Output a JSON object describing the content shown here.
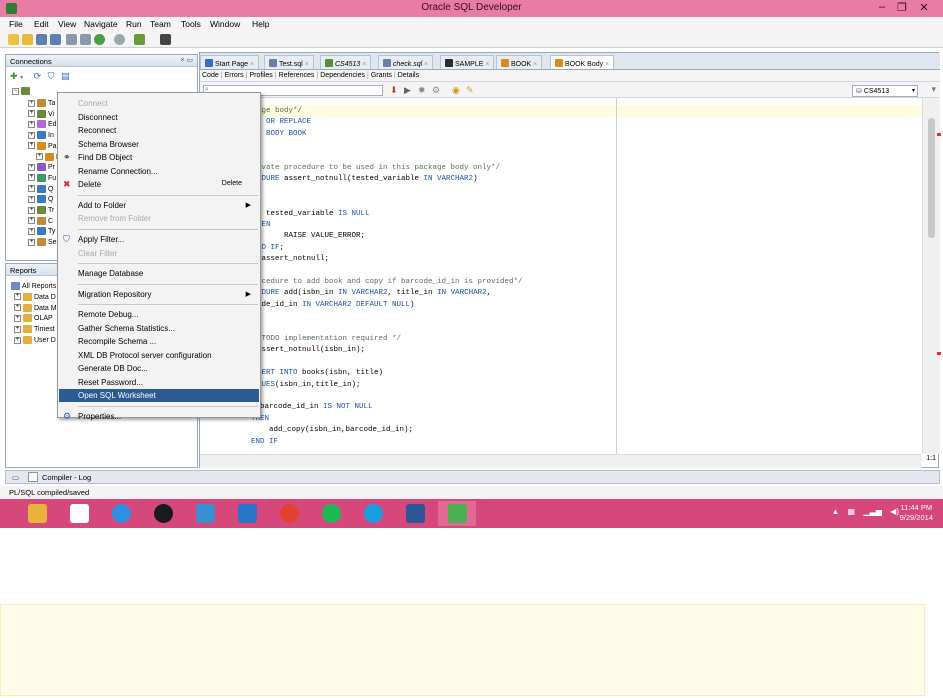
{
  "window": {
    "title": "Oracle SQL Developer",
    "controls": {
      "minimize": "–",
      "restore": "❐",
      "close": "✕"
    }
  },
  "menubar": [
    "File",
    "Edit",
    "View",
    "Navigate",
    "Run",
    "Team",
    "Tools",
    "Window",
    "Help"
  ],
  "connections_pane": {
    "title": "Connections",
    "tree": [
      "Ta",
      "Vi",
      "Ed",
      "In",
      "Pa",
      "P",
      "Pr",
      "Fu",
      "Q",
      "Q",
      "Tr",
      "C",
      "Ty",
      "Se"
    ]
  },
  "reports_pane": {
    "title": "Reports",
    "tree": [
      "All Reports",
      "Data D",
      "Data M",
      "OLAP",
      "Timest",
      "User D"
    ]
  },
  "editor": {
    "tabs": [
      {
        "label": "Start Page",
        "icon": "help-icon",
        "color": "#3b6cc9"
      },
      {
        "label": "Test.sql",
        "icon": "sql-file-icon",
        "color": "#6a7fa8"
      },
      {
        "label": "CS4513",
        "icon": "connection-icon",
        "color": "#5a8a3a"
      },
      {
        "label": "check.sql",
        "icon": "sql-file-icon",
        "color": "#6a7fa8"
      },
      {
        "label": "SAMPLE",
        "icon": "sql-file-icon",
        "color": "#2b2b2b"
      },
      {
        "label": "BOOK",
        "icon": "package-icon",
        "color": "#d98b1e"
      },
      {
        "label": "BOOK Body",
        "icon": "package-body-icon",
        "color": "#d98b1e"
      }
    ],
    "subtabs": [
      "Code",
      "Errors",
      "Profiles",
      "References",
      "Dependencies",
      "Grants",
      "Details"
    ],
    "search_value": "",
    "connection_selected": "CS4513",
    "cursor_position": "1:1",
    "code_lines": [
      [
        {
          "t": "age body*/",
          "c": "cm"
        }
      ],
      [
        {
          "t": "  ",
          "c": ""
        },
        {
          "t": "OR REPLACE",
          "c": "kw"
        }
      ],
      [
        {
          "t": "E BODY BOOK",
          "c": "kw"
        }
      ],
      [],
      [],
      [
        {
          "t": "ivate procedure to be used in this package body only*/",
          "c": "cm"
        }
      ],
      [
        {
          "t": "EDURE",
          "c": "kw"
        },
        {
          "t": " assert_notnull(tested_variable ",
          "c": ""
        },
        {
          "t": "IN VARCHAR2",
          "c": "kw"
        },
        {
          "t": ")",
          "c": ""
        }
      ],
      [],
      [
        {
          "t": "N",
          "c": "kw"
        }
      ],
      [
        {
          "t": "F",
          "c": "kw"
        },
        {
          "t": " tested_variable ",
          "c": ""
        },
        {
          "t": "IS NULL",
          "c": "kw"
        }
      ],
      [
        {
          "t": "HEN",
          "c": "kw"
        }
      ],
      [
        {
          "t": "      RAISE VALUE_ERROR;",
          "c": ""
        }
      ],
      [
        {
          "t": "ND IF",
          "c": "kw"
        },
        {
          "t": ";",
          "c": ""
        }
      ],
      [
        {
          "t": " assert_notnull;",
          "c": ""
        }
      ],
      [],
      [
        {
          "t": "ocedure to add book and copy if barcode_id_in is provided*/",
          "c": "cm"
        }
      ],
      [
        {
          "t": "EDURE",
          "c": "kw"
        },
        {
          "t": " add(isbn_in ",
          "c": ""
        },
        {
          "t": "IN VARCHAR2",
          "c": "kw"
        },
        {
          "t": ", title_in ",
          "c": ""
        },
        {
          "t": "IN VARCHAR2",
          "c": "kw"
        },
        {
          "t": ",",
          "c": ""
        }
      ],
      [
        {
          "t": "ode_id_in ",
          "c": ""
        },
        {
          "t": "IN VARCHAR2 DEFAULT NULL",
          "c": "kw"
        },
        {
          "t": ")",
          "c": ""
        }
      ],
      [],
      [
        {
          "t": "N",
          "c": "kw"
        }
      ],
      [
        {
          "t": " TODO implementation required */",
          "c": "cm"
        }
      ],
      [
        {
          "t": "assert_notnull(isbn_in);",
          "c": ""
        }
      ],
      [],
      [
        {
          "t": "SERT INTO",
          "c": "kw"
        },
        {
          "t": " books(isbn, title)",
          "c": ""
        }
      ],
      [
        {
          "t": "LUES",
          "c": "kw"
        },
        {
          "t": "(isbn_in,title_in);",
          "c": ""
        }
      ],
      [],
      [
        {
          "t": "  barcode_id_in ",
          "c": ""
        },
        {
          "t": "IS NOT NULL",
          "c": "kw"
        }
      ],
      [
        {
          "t": "THEN",
          "c": "kw"
        }
      ],
      [
        {
          "t": "    add_copy(isbn_in,barcode_id_in);",
          "c": ""
        }
      ],
      [
        {
          "t": "END IF",
          "c": "kw"
        }
      ]
    ]
  },
  "context_menu": {
    "items": [
      {
        "label": "Connect",
        "disabled": true
      },
      {
        "label": "Disconnect"
      },
      {
        "label": "Reconnect"
      },
      {
        "label": "Schema Browser"
      },
      {
        "label": "Find DB Object",
        "icon": "binoculars-icon"
      },
      {
        "label": "Rename Connection..."
      },
      {
        "label": "Delete",
        "icon": "delete-x-icon",
        "shortcut": "Delete"
      },
      {
        "sep": true
      },
      {
        "label": "Add to Folder",
        "submenu": true
      },
      {
        "label": "Remove from Folder",
        "disabled": true
      },
      {
        "sep": true
      },
      {
        "label": "Apply Filter...",
        "icon": "filter-icon"
      },
      {
        "label": "Clear Filter",
        "disabled": true
      },
      {
        "sep": true
      },
      {
        "label": "Manage Database"
      },
      {
        "sep": true
      },
      {
        "label": "Migration Repository",
        "submenu": true
      },
      {
        "sep": true
      },
      {
        "label": "Remote Debug..."
      },
      {
        "label": "Gather Schema Statistics..."
      },
      {
        "label": "Recompile Schema ..."
      },
      {
        "label": "XML DB Protocol server configuration"
      },
      {
        "label": "Generate DB Doc..."
      },
      {
        "label": "Reset Password..."
      },
      {
        "label": "Open SQL Worksheet",
        "selected": true
      },
      {
        "sep": true
      },
      {
        "label": "Properties...",
        "icon": "properties-icon"
      }
    ]
  },
  "log": {
    "title": "Compiler - Log"
  },
  "status": "PL/SQL compiled/saved",
  "taskbar": {
    "apps": [
      {
        "name": "file-explorer-icon",
        "color": "#e8b33a"
      },
      {
        "name": "home-icon",
        "color": "#ffffff"
      },
      {
        "name": "internet-explorer-icon",
        "color": "#2f8fe0"
      },
      {
        "name": "media-icon",
        "color": "#1a1a1a"
      },
      {
        "name": "remote-desktop-icon",
        "color": "#3a8fd0"
      },
      {
        "name": "mail-icon",
        "color": "#2a75c8"
      },
      {
        "name": "chrome-icon",
        "color": "#e5402f"
      },
      {
        "name": "spotify-icon",
        "color": "#1db954"
      },
      {
        "name": "skype-icon",
        "color": "#1a9ee0"
      },
      {
        "name": "word-icon",
        "color": "#2b5797"
      },
      {
        "name": "sql-developer-icon",
        "color": "#4caf50"
      }
    ],
    "time": "11:44 PM",
    "date": "9/29/2014"
  },
  "colors": {
    "titlebar": "#e87ca3",
    "taskbar": "#d6477c",
    "menu_selected": "#2c5a93",
    "keyword": "#1b4fa8"
  }
}
